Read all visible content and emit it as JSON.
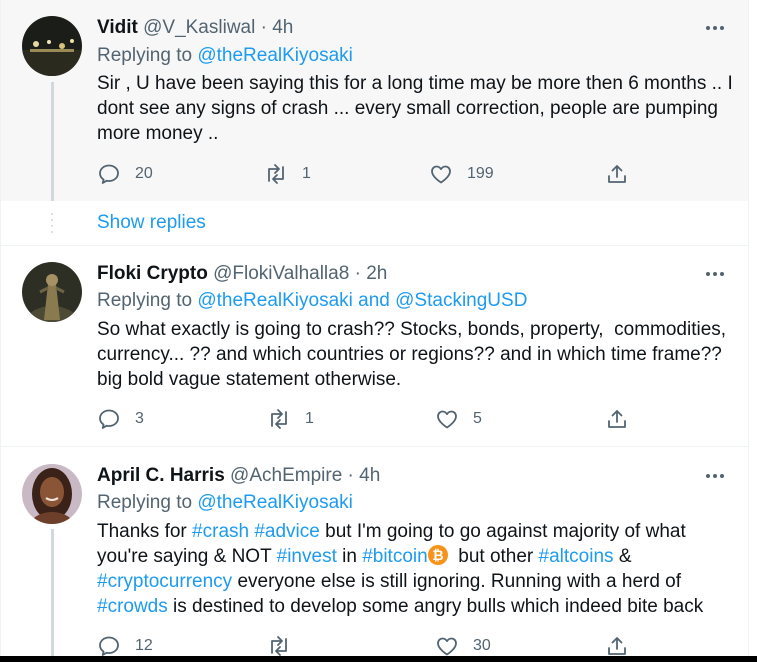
{
  "tweets": [
    {
      "name": "Vidit",
      "handle": "@V_Kasliwal",
      "sep": "·",
      "time": "4h",
      "replying_label": "Replying to",
      "mentions": [
        "@theRealKiyosaki"
      ],
      "text": "Sir , U have been saying this for a long time may be more then 6 months .. I dont see any signs of crash ... every small correction, people are pumping more money ..",
      "replies": "20",
      "retweets": "1",
      "likes": "199"
    },
    {
      "name": "Floki Crypto",
      "handle": "@FlokiValhalla8",
      "sep": "·",
      "time": "2h",
      "replying_label": "Replying to",
      "mentions": [
        "@theRealKiyosaki",
        "@StackingUSD"
      ],
      "mention_joiner": "and",
      "text": "So what exactly is going to crash?? Stocks, bonds, property,  commodities, currency... ?? and which countries or regions?? and in which time frame?? big bold vague statement otherwise.",
      "replies": "3",
      "retweets": "1",
      "likes": "5"
    },
    {
      "name": "April C. Harris",
      "handle": "@AchEmpire",
      "sep": "·",
      "time": "4h",
      "replying_label": "Replying to",
      "mentions": [
        "@theRealKiyosaki"
      ],
      "text_parts": {
        "p1": "Thanks for ",
        "tag_crash": "#crash",
        "p2": " ",
        "tag_advice": "#advice",
        "p3": " but I'm going to go against majority of what you're saying & NOT ",
        "tag_invest": "#invest",
        "p4": " in ",
        "tag_bitcoin": "#bitcoin",
        "p5": "  but other ",
        "tag_altcoins": "#altcoins",
        "p6": " & ",
        "tag_crypto": "#cryptocurrency",
        "p7": " everyone else is still ignoring. Running with a herd of ",
        "tag_crowds": "#crowds",
        "p8": " is destined to develop some angry bulls which indeed bite back"
      },
      "replies": "12",
      "retweets": "",
      "likes": "30"
    }
  ],
  "show_replies": "Show replies",
  "colors": {
    "link": "#1d9bf0",
    "muted": "#536471",
    "text": "#0f1419",
    "bitcoin": "#f7931a",
    "highlight_bg": "#f7f7f7"
  },
  "icons": [
    "reply-icon",
    "retweet-icon",
    "like-icon",
    "share-icon",
    "more-icon",
    "bitcoin-emoji"
  ]
}
